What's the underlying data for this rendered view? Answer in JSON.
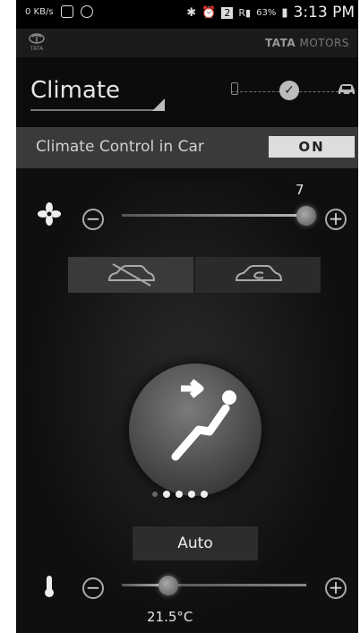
{
  "status_bar": {
    "speed_label": "0 KB/s",
    "signal_label": "R",
    "sim_label": "2",
    "battery_percent": "63%",
    "time": "3:13 PM"
  },
  "brand": {
    "logo_text": "TATA",
    "name_bold": "TATA",
    "name_rest": " MOTORS"
  },
  "header": {
    "title": "Climate",
    "mode_icons": [
      "phone-icon",
      "check-icon",
      "car-icon"
    ]
  },
  "climate_control": {
    "label": "Climate Control in Car",
    "toggle": "ON"
  },
  "fan": {
    "icon": "fan-icon",
    "value": "7",
    "level_fraction": 1.0
  },
  "airflow": {
    "options": [
      "recirculation-off",
      "recirculation-on"
    ]
  },
  "vent": {
    "icon": "seat-airflow-icon",
    "pages": 5,
    "current_page": 1
  },
  "auto_button": "Auto",
  "temperature": {
    "icon": "thermometer-icon",
    "value": "21.5°C",
    "level_fraction": 0.25
  },
  "colors": {
    "background": "#0f0f0f",
    "row_bg": "#3a3a3a",
    "toggle_bg": "#dddddd",
    "text": "#e6e6e6"
  }
}
